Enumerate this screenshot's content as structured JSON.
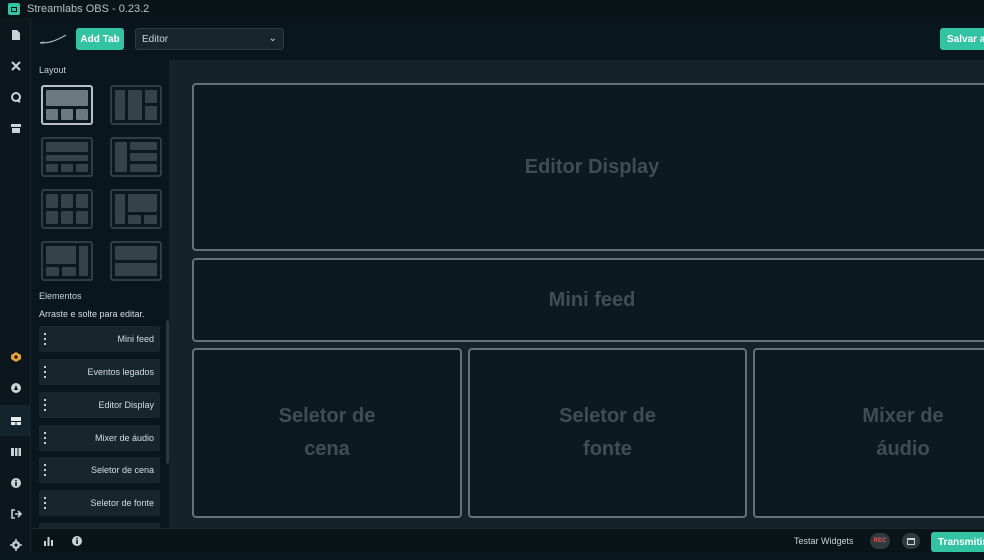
{
  "window": {
    "title": "Streamlabs OBS - 0.23.2"
  },
  "toolbar": {
    "add_tab_label": "Add Tab",
    "tab_select_value": "Editor",
    "save_label": "Salvar al"
  },
  "sidebar": {
    "layout_label": "Layout",
    "elements_label": "Elementos",
    "elements_hint": "Arraste e solte para editar.",
    "elements": [
      {
        "label": "Mini feed"
      },
      {
        "label": "Eventos legados"
      },
      {
        "label": "Editor Display"
      },
      {
        "label": "Mixer de áudio"
      },
      {
        "label": "Seletor de cena"
      },
      {
        "label": "Seletor de fonte"
      }
    ]
  },
  "canvas": {
    "panels": [
      {
        "label": "Editor Display"
      },
      {
        "label": "Mini feed"
      },
      {
        "line1": "Seletor de",
        "line2": "cena"
      },
      {
        "line1": "Seletor de",
        "line2": "fonte"
      },
      {
        "line1": "Mixer de",
        "line2": "áudio"
      }
    ]
  },
  "footer": {
    "test_widgets_label": "Testar Widgets",
    "rec_label": "REC",
    "go_live_label": "Transmitir"
  },
  "colors": {
    "accent": "#31c3a2",
    "background": "#09161d",
    "panel_border": "#63727a",
    "panel_text": "#3f4d54"
  },
  "icons": {
    "nav_top": [
      "file-icon",
      "tools-icon",
      "chat-icon",
      "store-icon"
    ],
    "nav_bottom": [
      "help-icon",
      "theme-icon",
      "layout-editor-icon",
      "studio-mode-icon",
      "info-icon",
      "logout-icon",
      "settings-icon"
    ],
    "footer": [
      "stats-icon",
      "info-icon",
      "calendar-icon"
    ]
  }
}
